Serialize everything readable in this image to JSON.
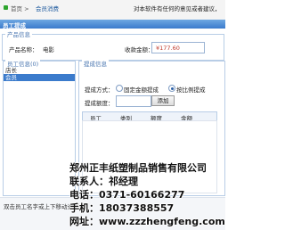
{
  "top": {
    "tab_text": "首页 >",
    "tab_main": "会员消费",
    "notice": "对本软件有任何的意见或者建议，"
  },
  "window_title": "员工提成",
  "product": {
    "legend": "产品信息",
    "name_label": "产品名称：",
    "name_value": "电影",
    "amount_label": "收款金额：",
    "amount_value": "¥177.60"
  },
  "staff": {
    "legend": "员工信息(0)",
    "items": [
      "店长",
      "会员"
    ],
    "selected_index": 1
  },
  "commission": {
    "legend": "提成信息",
    "mode_label": "提成方式：",
    "options": [
      "固定金额提成",
      "按比例提成"
    ],
    "selected_option": 1,
    "amount_label": "提成额度：",
    "add_button": "添加",
    "columns": [
      "员工",
      "类别",
      "额度",
      "金额"
    ]
  },
  "hint": "双击员工名字或上下移动光标",
  "ad": {
    "line1": "郑州正丰纸塑制品销售有限公司",
    "line2": "联系人：祁经理",
    "line3": "电话：0371-60166277",
    "line4": "手机：18037388557",
    "line5": "网址：www.zzzhengfeng.com"
  }
}
